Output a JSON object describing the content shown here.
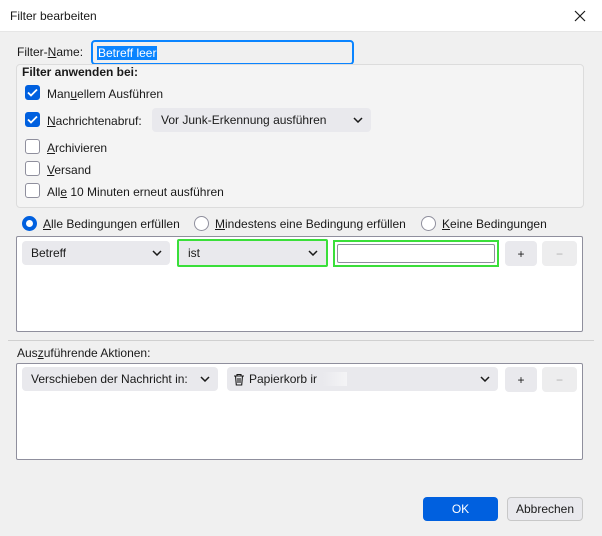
{
  "window": {
    "title": "Filter bearbeiten",
    "close_icon": "close-icon"
  },
  "filter_name": {
    "label": "Filter-Name:",
    "value": "Betreff leer"
  },
  "apply_group": {
    "heading": "Filter anwenden bei:",
    "manual": {
      "label": "Manuellem Ausführen",
      "checked": true
    },
    "fetch": {
      "label": "Nachrichtenabruf:",
      "checked": true,
      "dropdown_value": "Vor Junk-Erkennung ausführen"
    },
    "archive": {
      "label": "Archivieren",
      "checked": false
    },
    "send": {
      "label": "Versand",
      "checked": false
    },
    "periodic": {
      "label": "Alle 10 Minuten erneut ausführen",
      "checked": false
    }
  },
  "match": {
    "all": "Alle Bedingungen erfüllen",
    "any": "Mindestens eine Bedingung erfüllen",
    "none": "Keine Bedingungen",
    "selected": "all"
  },
  "condition": {
    "field": "Betreff",
    "operator": "ist",
    "value": "",
    "add": "+",
    "remove": "−"
  },
  "actions": {
    "label": "Auszuführende Aktionen:",
    "action": "Verschieben der Nachricht in:",
    "target": "Papierkorb ir",
    "add": "+",
    "remove": "−"
  },
  "buttons": {
    "ok": "OK",
    "cancel": "Abbrechen"
  },
  "colors": {
    "accent": "#0060df",
    "focus": "#0a84ff",
    "highlight_outline": "#3adf3a"
  }
}
